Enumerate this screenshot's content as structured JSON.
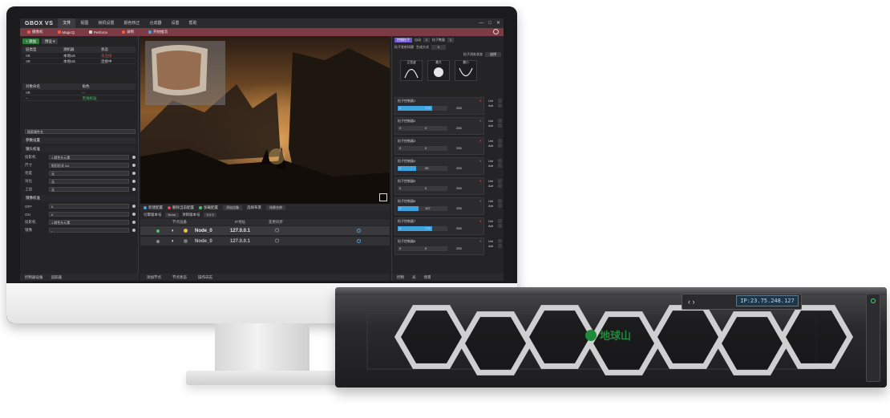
{
  "app": {
    "logo": "GBOX VS",
    "menu": [
      "文件",
      "视图",
      "帧机设置",
      "颜色矫正",
      "合成器",
      "设置",
      "帮助"
    ],
    "window_controls": [
      "—",
      "□",
      "✕"
    ]
  },
  "toolbar": [
    {
      "label": "摄像机",
      "color": "#e85a4a"
    },
    {
      "label": "MagicQ",
      "color": "#e85a4a"
    },
    {
      "label": "Perforce",
      "color": "#d0d0d0"
    },
    {
      "label": "录制",
      "color": "#e85a4a"
    },
    {
      "label": "开始推流",
      "color": "#3fa3e0"
    }
  ],
  "left_panel": {
    "add_label": "+ 添加",
    "preset_label": "预设 ▾",
    "table1": {
      "headers": [
        "层类型",
        "源机器",
        "状态"
      ],
      "rows": [
        [
          "V8",
          "本地UE",
          "未连接"
        ],
        [
          "V9",
          "本地UE",
          "连接中"
        ]
      ]
    },
    "table2": {
      "headers": [
        "对象命名",
        "角色"
      ],
      "rows": [
        [
          "V8",
          "--"
        ],
        [
          "--",
          "无线校准"
        ]
      ]
    },
    "search_placeholder": "搜索属性名",
    "section_label": "参数设置",
    "sub_sections": [
      "镜头校准",
      "镜像校准"
    ],
    "props": [
      {
        "label": "投影机",
        "value": "1 颜色头元素"
      },
      {
        "label": "尺寸",
        "value": "矩形形式 A4"
      },
      {
        "label": "亮度",
        "value": "无"
      },
      {
        "label": "对比",
        "value": "无"
      },
      {
        "label": "上边",
        "value": "无"
      },
      {
        "label": "OFF",
        "value": "0"
      },
      {
        "label": "ON",
        "value": "0"
      },
      {
        "label": "投影机",
        "value": "1 颜色头元素"
      },
      {
        "label": "镜像",
        "value": "-"
      }
    ],
    "bottom_tabs": [
      "控制器设备",
      "追踪器"
    ]
  },
  "node_panel": {
    "bar_items": [
      "新建配置",
      "删除当前配置",
      "加载配置",
      "添加设备"
    ],
    "template_label": "选择布景",
    "template_value": "场景名称",
    "filter": {
      "engine_label": "引擎版本号",
      "engine_value": "None",
      "project_label": "项目版本号",
      "project_value": "5.0.3"
    },
    "headers": [
      "节点设备",
      "IP地址",
      "变更同步"
    ],
    "rows": [
      {
        "name": "Node_0",
        "ip": "127.0.0.1"
      },
      {
        "name": "Node_0",
        "ip": "127.0.0.1"
      }
    ],
    "tabs": [
      "添加节点",
      "节点状态",
      "操作日志"
    ]
  },
  "right_panel": {
    "tab_label": "控制粒子",
    "mode_label": "自动",
    "mode_value": "1",
    "rate_label": "粒子数量",
    "rate_value": "1",
    "sub_labels": [
      "粒子发射间隔",
      "生成方式",
      "0"
    ],
    "choose_label": "粒子消失状态",
    "choose_value": "选择",
    "curves": [
      "正弦波",
      "最大",
      "最小"
    ],
    "channels": [
      {
        "name": "粒子控制器1",
        "min": "0",
        "cur": "175",
        "max": "255",
        "fill": 0.69
      },
      {
        "name": "粒子控制器2",
        "min": "0",
        "cur": "0",
        "max": "255",
        "fill": 0
      },
      {
        "name": "粒子控制器3",
        "min": "0",
        "cur": "0",
        "max": "255",
        "fill": 0
      },
      {
        "name": "粒子控制器4",
        "min": "0",
        "cur": "95",
        "max": "255",
        "fill": 0.37
      },
      {
        "name": "粒子控制器5",
        "min": "0",
        "cur": "0",
        "max": "255",
        "fill": 0
      },
      {
        "name": "粒子控制器6",
        "min": "0",
        "cur": "107",
        "max": "255",
        "fill": 0.42
      },
      {
        "name": "粒子控制器7",
        "min": "0",
        "cur": "175",
        "max": "255",
        "fill": 0.69
      },
      {
        "name": "粒子控制器8",
        "min": "0",
        "cur": "0",
        "max": "255",
        "fill": 0
      }
    ],
    "side_labels": [
      "Uni",
      "Adr"
    ],
    "bottom_tabs": [
      "控制",
      "光",
      "场景"
    ]
  },
  "server": {
    "ip_display": "IP:23.75.248.127",
    "brand": "地球山"
  },
  "colors": {
    "accent": "#7c3a44",
    "highlight": "#3fa3e0",
    "brand_green": "#1f8a3a"
  }
}
